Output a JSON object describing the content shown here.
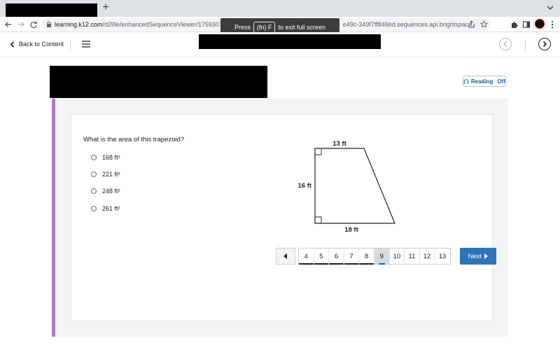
{
  "browser": {
    "new_tab": "+",
    "url_host": "learning.k12.com",
    "url_path_start": "/d2l/le/enhancedSequenceViewer/1759307?url=https",
    "url_path_end": "e49c-349f7ff846bd.sequences.api.brightspace.com%2F..."
  },
  "fullscreen_toast": {
    "press": "Press",
    "key": "(fn) F",
    "suffix": "to exit full screen"
  },
  "nav": {
    "back_label": "Back to Content"
  },
  "reading": {
    "label": "Reading",
    "state": "Off"
  },
  "question": {
    "text": "What is the area of this trapezoid?",
    "choices": [
      "168 ft²",
      "221 ft²",
      "248 ft²",
      "261 ft²"
    ]
  },
  "figure": {
    "top_label": "13 ft",
    "left_label": "16 ft",
    "bottom_label": "18 ft"
  },
  "pager": {
    "pages": [
      "4",
      "5",
      "6",
      "7",
      "8",
      "9",
      "10",
      "11",
      "12",
      "13"
    ],
    "current": "9",
    "next_label": "Next"
  },
  "colors": {
    "accent_purple": "#b07ac9",
    "next_button": "#2f75b5",
    "current_indicator": "#006fbf"
  }
}
